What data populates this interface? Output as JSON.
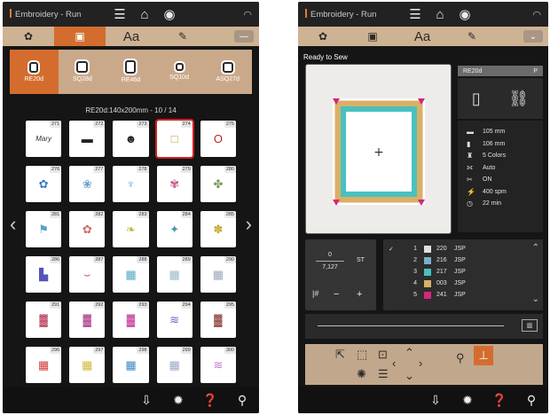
{
  "app_title": "Embroidery - Run",
  "colors": {
    "accent": "#d36d2f",
    "tab_bar": "#cdb293",
    "edit_panel": "#c1a78c",
    "background": "#151515",
    "selection": "#d32020"
  },
  "topbar_icons": [
    "hamburger-menu-icon",
    "home-icon",
    "record-icon",
    "wifi-icon"
  ],
  "tabs": [
    {
      "name": "embroidery-designs-tab",
      "icon": "flower-icon"
    },
    {
      "name": "hoop-tab",
      "icon": "square-hoop-icon",
      "active": true
    },
    {
      "name": "text-tab",
      "label": "Aa"
    },
    {
      "name": "edit-tab",
      "icon": "pencil-frame-icon"
    }
  ],
  "left": {
    "hoops": [
      {
        "label": "RE20d",
        "active": true
      },
      {
        "label": "SQ28d"
      },
      {
        "label": "RE46d"
      },
      {
        "label": "SQ10d"
      },
      {
        "label": "ASQ27d"
      }
    ],
    "grid_caption": "RE20d:140x200mm - 10 / 14",
    "designs": [
      {
        "num": "271",
        "mark": "Mary",
        "color": "#333"
      },
      {
        "num": "272",
        "mark": "▬",
        "color": "#222"
      },
      {
        "num": "273",
        "mark": "☻",
        "color": "#222"
      },
      {
        "num": "274",
        "mark": "□",
        "color": "#c9a13a",
        "selected": true
      },
      {
        "num": "275",
        "mark": "O",
        "color": "#c0202a"
      },
      {
        "num": "276",
        "mark": "✿",
        "color": "#3a7ec0"
      },
      {
        "num": "277",
        "mark": "❀",
        "color": "#6aa0c8"
      },
      {
        "num": "278",
        "mark": "♆",
        "color": "#6aa0c8"
      },
      {
        "num": "279",
        "mark": "✾",
        "color": "#c25a8a"
      },
      {
        "num": "280",
        "mark": "✤",
        "color": "#7c9c5a"
      },
      {
        "num": "281",
        "mark": "⚑",
        "color": "#5aa0c8"
      },
      {
        "num": "282",
        "mark": "✿",
        "color": "#d26a6a"
      },
      {
        "num": "283",
        "mark": "❧",
        "color": "#c6b848"
      },
      {
        "num": "284",
        "mark": "✦",
        "color": "#4a9aa8"
      },
      {
        "num": "285",
        "mark": "✽",
        "color": "#c2a82a"
      },
      {
        "num": "286",
        "mark": "▙",
        "color": "#5454b8"
      },
      {
        "num": "287",
        "mark": "⌣",
        "color": "#c24a8a"
      },
      {
        "num": "288",
        "mark": "▦",
        "color": "#55a8c8"
      },
      {
        "num": "289",
        "mark": "▦",
        "color": "#9ab8c8"
      },
      {
        "num": "290",
        "mark": "▦",
        "color": "#9aa8b8"
      },
      {
        "num": "291",
        "mark": "▓",
        "color": "#b43a5a"
      },
      {
        "num": "292",
        "mark": "▓",
        "color": "#a83a88"
      },
      {
        "num": "293",
        "mark": "▓",
        "color": "#c23a9a"
      },
      {
        "num": "294",
        "mark": "≋",
        "color": "#7a5ac8"
      },
      {
        "num": "295",
        "mark": "▓",
        "color": "#8a3a3a"
      },
      {
        "num": "296",
        "mark": "▦",
        "color": "#d23a3a"
      },
      {
        "num": "297",
        "mark": "▦",
        "color": "#d2b83a"
      },
      {
        "num": "298",
        "mark": "▦",
        "color": "#3a8ac8"
      },
      {
        "num": "299",
        "mark": "▦",
        "color": "#9aa8c8"
      },
      {
        "num": "300",
        "mark": "≋",
        "color": "#b87ac8"
      }
    ]
  },
  "right": {
    "status": "Ready to Sew",
    "info_head_left": "RE20d",
    "info_head_right": "P",
    "info": [
      {
        "icon": "width-icon",
        "value": "105 mm"
      },
      {
        "icon": "height-icon",
        "value": "106 mm"
      },
      {
        "icon": "thread-colors-icon",
        "value": "5 Colors"
      },
      {
        "icon": "tension-icon",
        "value": "Auto"
      },
      {
        "icon": "cutter-icon",
        "value": "ON"
      },
      {
        "icon": "speed-icon",
        "value": "400 spm"
      },
      {
        "icon": "time-icon",
        "value": "22 min"
      }
    ],
    "stitch": {
      "current": "0",
      "unit": "ST",
      "total": "7,127",
      "minus": "−",
      "plus": "+",
      "hash": "|#"
    },
    "thread_colors": [
      {
        "idx": "1",
        "code": "220",
        "brand": "JSP",
        "color": "#e0e0e0",
        "checked": true
      },
      {
        "idx": "2",
        "code": "216",
        "brand": "JSP",
        "color": "#7ab0c8"
      },
      {
        "idx": "3",
        "code": "217",
        "brand": "JSP",
        "color": "#4ac0c0"
      },
      {
        "idx": "4",
        "code": "003",
        "brand": "JSP",
        "color": "#d9b066"
      },
      {
        "idx": "5",
        "code": "241",
        "brand": "JSP",
        "color": "#d6257d"
      }
    ]
  },
  "bottombar_icons": [
    "import-icon",
    "settings-icon",
    "help-icon",
    "tools-icon"
  ]
}
